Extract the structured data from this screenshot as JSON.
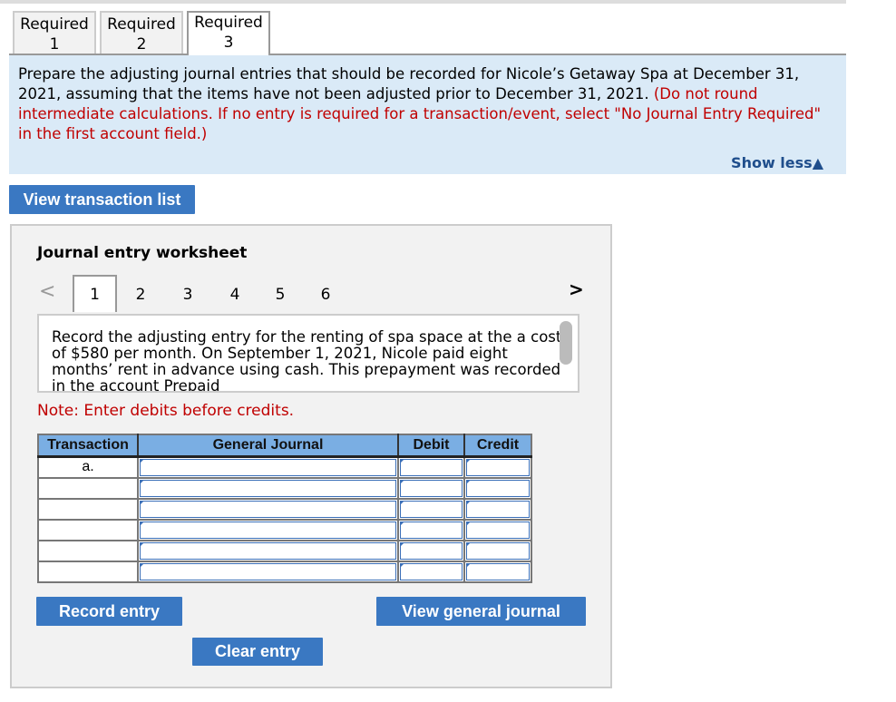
{
  "tabs": [
    {
      "line1": "Required",
      "line2": "1"
    },
    {
      "line1": "Required",
      "line2": "2"
    },
    {
      "line1": "Required",
      "line2": "3"
    }
  ],
  "instructions": {
    "text": "Prepare the adjusting journal entries that should be recorded for Nicole’s Getaway Spa at December 31, 2021, assuming that the items have not been adjusted prior to December 31, 2021.",
    "note": "(Do not round intermediate calculations. If no entry is required for a transaction/event, select \"No Journal Entry Required\" in the first account field.)"
  },
  "show_less": "Show less▲",
  "view_transaction_list": "View transaction list",
  "worksheet": {
    "title": "Journal entry worksheet",
    "pages": [
      "1",
      "2",
      "3",
      "4",
      "5",
      "6"
    ],
    "current_page": "1",
    "description": "Record the adjusting entry for the renting of spa space at the a cost of $580 per month. On September 1, 2021, Nicole paid eight months’ rent in advance using cash. This prepayment was recorded in the account Prepaid",
    "note": "Note: Enter debits before credits.",
    "table": {
      "headers": [
        "Transaction",
        "General Journal",
        "Debit",
        "Credit"
      ],
      "rows": [
        {
          "transaction": "a."
        },
        {
          "transaction": ""
        },
        {
          "transaction": ""
        },
        {
          "transaction": ""
        },
        {
          "transaction": ""
        },
        {
          "transaction": ""
        }
      ]
    },
    "record_entry": "Record entry",
    "view_general_journal": "View general journal",
    "clear_entry": "Clear entry"
  },
  "colors": {
    "accent": "#3a78c2",
    "header": "#7aaee3",
    "instruction_bg": "#daeaf7",
    "red": "#c00000"
  }
}
